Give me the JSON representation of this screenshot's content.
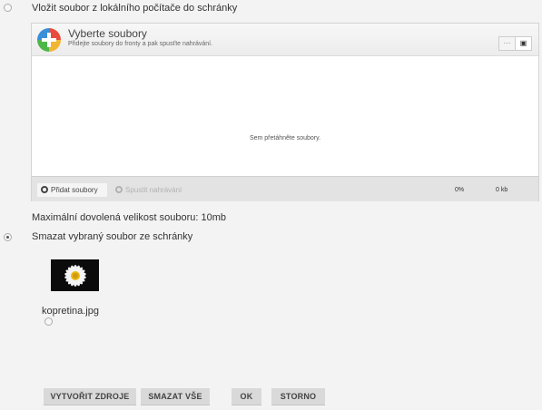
{
  "option_upload": {
    "label": "Vložit soubor z lokálního počítače do schránky",
    "selected": false
  },
  "uploader": {
    "title": "Vyberte soubory",
    "subtitle": "Přidejte soubory do fronty a pak spusťte nahrávání.",
    "view_list_glyph": "⋯",
    "view_thumbs_glyph": "▣",
    "drop_text": "Sem přetáhněte soubory.",
    "add_label": "Přidat soubory",
    "start_label": "Spustit nahrávání",
    "progress": "0%",
    "size": "0 kb",
    "logo_icon": "add-plus-icon"
  },
  "max_size_text": "Maximální dovolená velikost souboru: 10mb",
  "option_delete": {
    "label": "Smazat vybraný soubor ze schránky",
    "selected": true
  },
  "file": {
    "name": "kopretina.jpg",
    "thumbnail": "daisy-flower-image"
  },
  "buttons": {
    "create": "VYTVOŘIT ZDROJE",
    "delete_all": "SMAZAT VŠE",
    "ok": "OK",
    "cancel": "STORNO"
  }
}
